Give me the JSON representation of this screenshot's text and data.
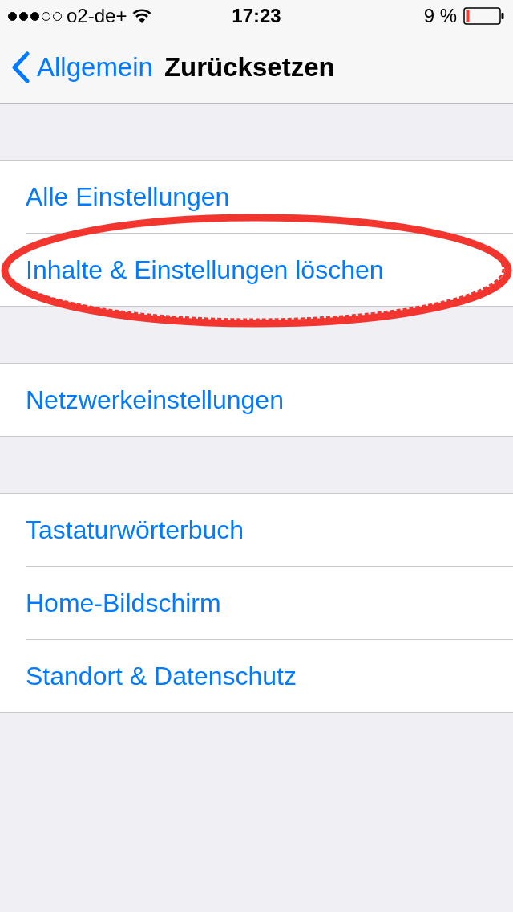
{
  "status_bar": {
    "carrier": "o2-de+",
    "time": "17:23",
    "battery": "9 %"
  },
  "nav": {
    "back": "Allgemein",
    "title": "Zurücksetzen"
  },
  "sections": [
    {
      "items": [
        {
          "label": "Alle Einstellungen",
          "circled": false
        },
        {
          "label": "Inhalte & Einstellungen löschen",
          "circled": true
        }
      ]
    },
    {
      "items": [
        {
          "label": "Netzwerkeinstellungen",
          "circled": false
        }
      ]
    },
    {
      "items": [
        {
          "label": "Tastaturwörterbuch",
          "circled": false
        },
        {
          "label": "Home-Bildschirm",
          "circled": false
        },
        {
          "label": "Standort & Datenschutz",
          "circled": false
        }
      ]
    }
  ]
}
